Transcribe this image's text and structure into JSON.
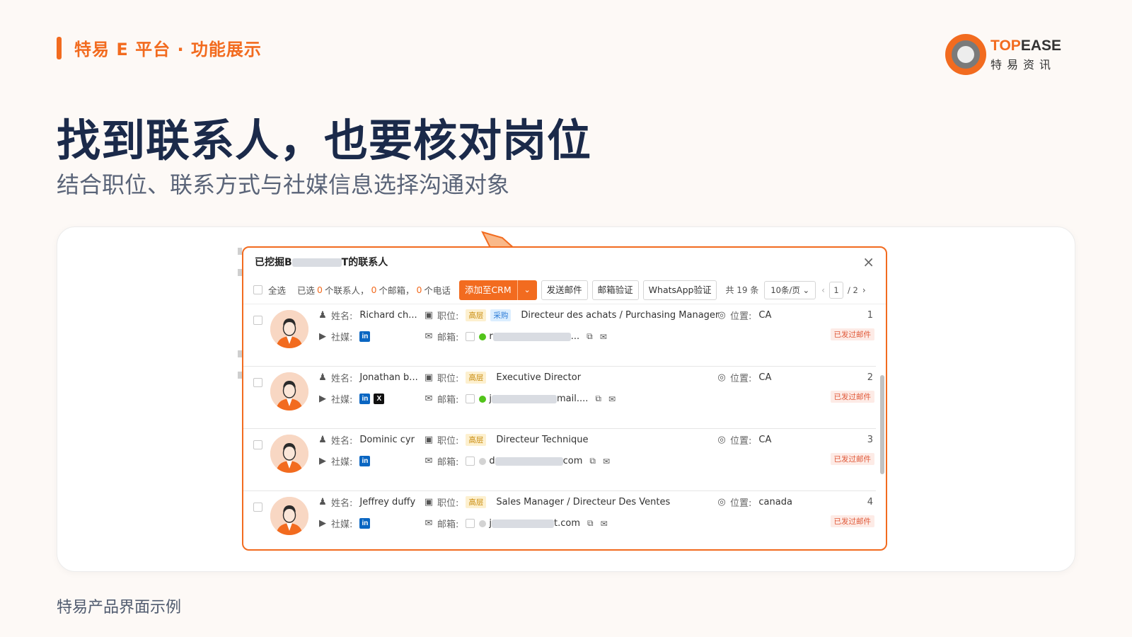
{
  "header": {
    "brand_text": "特易 E 平台 · 功能展示",
    "logo_top": "TOP",
    "logo_ease": "EASE",
    "logo_cn": "特易资讯"
  },
  "hero": {
    "title": "找到联系人，也要核对岗位",
    "subtitle": "结合职位、联系方式与社媒信息选择沟通对象"
  },
  "caption": "特易产品界面示例",
  "colors": {
    "accent": "#f26b1f",
    "title": "#1b2a4a",
    "linkedin": "#0a66c2",
    "ok": "#52c41a"
  },
  "modal": {
    "title_prefix": "已挖掘B",
    "title_suffix": "T的联系人",
    "close_icon": "×",
    "toolbar": {
      "select_all": "全选",
      "selected_prefix": "已选",
      "selected_contacts": "0",
      "contacts_unit": "个联系人，",
      "selected_emails": "0",
      "emails_unit": "个邮箱，",
      "selected_phones": "0",
      "phones_unit": "个电话",
      "add_crm": "添加至CRM",
      "dropdown_icon": "⌄",
      "send_email": "发送邮件",
      "verify_email": "邮箱验证",
      "verify_whatsapp": "WhatsApp验证",
      "total": "共 19 条",
      "page_size": "10条/页 ⌄",
      "prev": "‹",
      "current_page": "1",
      "total_pages": "/ 2",
      "next": "›"
    },
    "labels": {
      "name": "姓名:",
      "position": "职位:",
      "location": "位置:",
      "social": "社媒:",
      "email": "邮箱:",
      "sent_badge": "已发过邮件"
    },
    "contacts": [
      {
        "index": "1",
        "name": "Richard ch...",
        "tags": [
          "高层",
          "采购"
        ],
        "title": "Directeur des achats / Purchasing Manager",
        "location": "CA",
        "social": [
          "in"
        ],
        "email_start": "r",
        "email_end": "...",
        "verified": true
      },
      {
        "index": "2",
        "name": "Jonathan b...",
        "tags": [
          "高层"
        ],
        "title": "Executive Director",
        "location": "CA",
        "social": [
          "in",
          "X"
        ],
        "email_start": "j",
        "email_end": "mail....",
        "verified": true
      },
      {
        "index": "3",
        "name": "Dominic cyr",
        "tags": [
          "高层"
        ],
        "title": "Directeur Technique",
        "location": "CA",
        "social": [
          "in"
        ],
        "email_start": "d",
        "email_end": "com",
        "verified": false
      },
      {
        "index": "4",
        "name": "Jeffrey duffy",
        "tags": [
          "高层"
        ],
        "title": "Sales Manager / Directeur Des Ventes",
        "location": "canada",
        "social": [
          "in"
        ],
        "email_start": "j",
        "email_end": "t.com",
        "verified": false
      }
    ]
  }
}
